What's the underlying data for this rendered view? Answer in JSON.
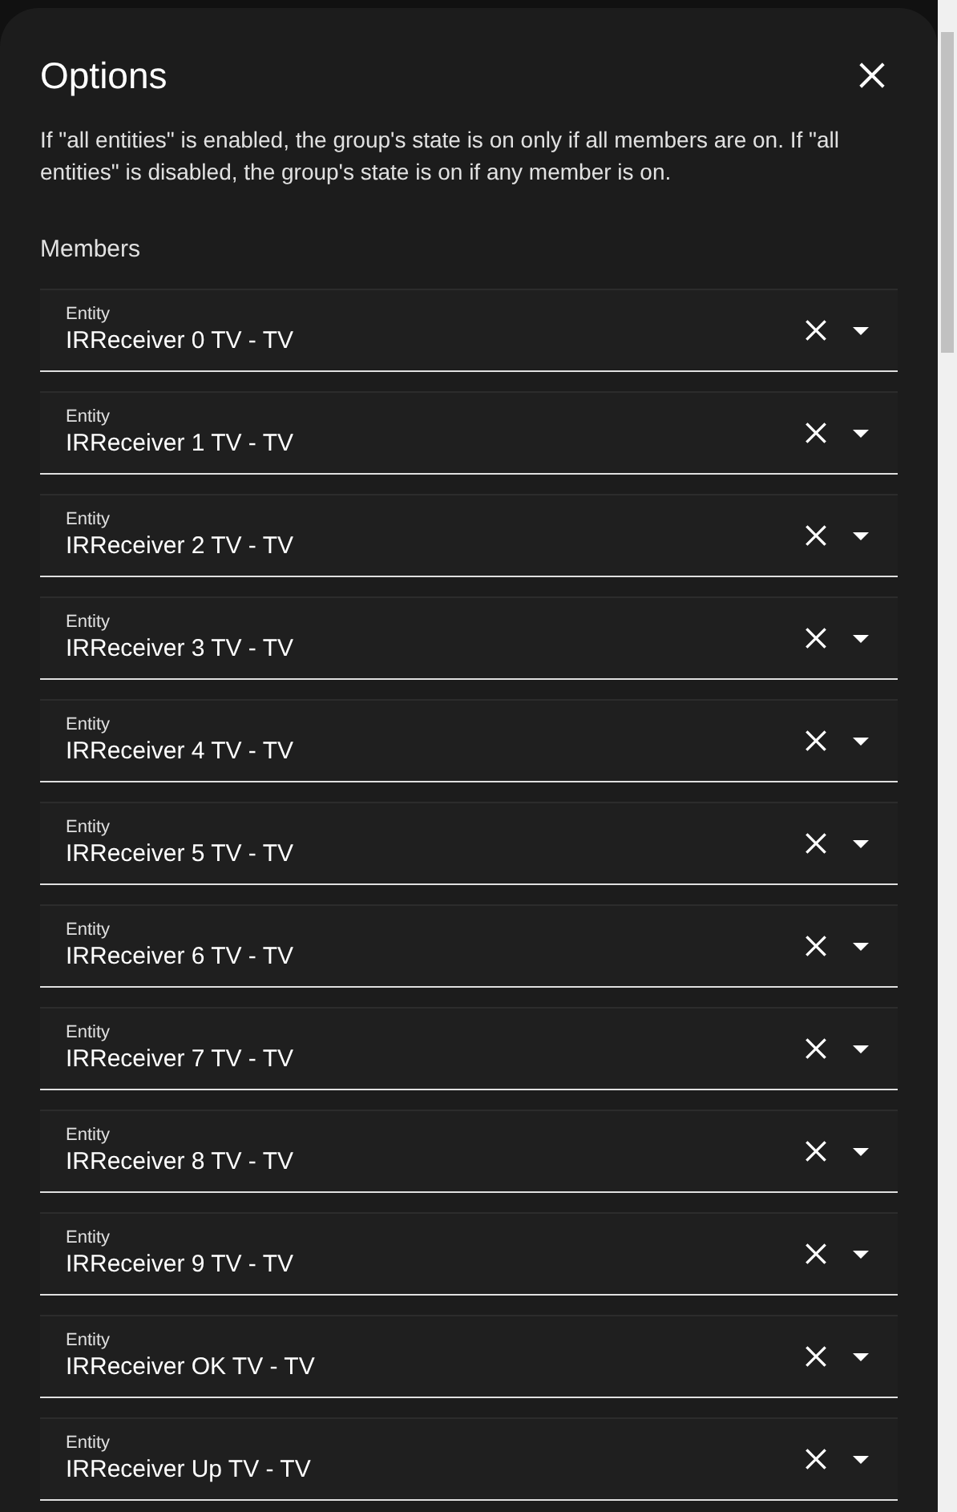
{
  "dialog": {
    "title": "Options",
    "description": "If \"all entities\" is enabled, the group's state is on only if all members are on. If \"all entities\" is disabled, the group's state is on if any member is on.",
    "section": "Members",
    "members": [
      {
        "label": "Entity",
        "value": "IRReceiver 0 TV - TV"
      },
      {
        "label": "Entity",
        "value": "IRReceiver 1 TV - TV"
      },
      {
        "label": "Entity",
        "value": "IRReceiver 2 TV - TV"
      },
      {
        "label": "Entity",
        "value": "IRReceiver 3 TV - TV"
      },
      {
        "label": "Entity",
        "value": "IRReceiver 4 TV - TV"
      },
      {
        "label": "Entity",
        "value": "IRReceiver 5 TV - TV"
      },
      {
        "label": "Entity",
        "value": "IRReceiver 6 TV - TV"
      },
      {
        "label": "Entity",
        "value": "IRReceiver 7 TV - TV"
      },
      {
        "label": "Entity",
        "value": "IRReceiver 8 TV - TV"
      },
      {
        "label": "Entity",
        "value": "IRReceiver 9 TV - TV"
      },
      {
        "label": "Entity",
        "value": "IRReceiver OK TV - TV"
      },
      {
        "label": "Entity",
        "value": "IRReceiver Up TV - TV"
      }
    ]
  }
}
